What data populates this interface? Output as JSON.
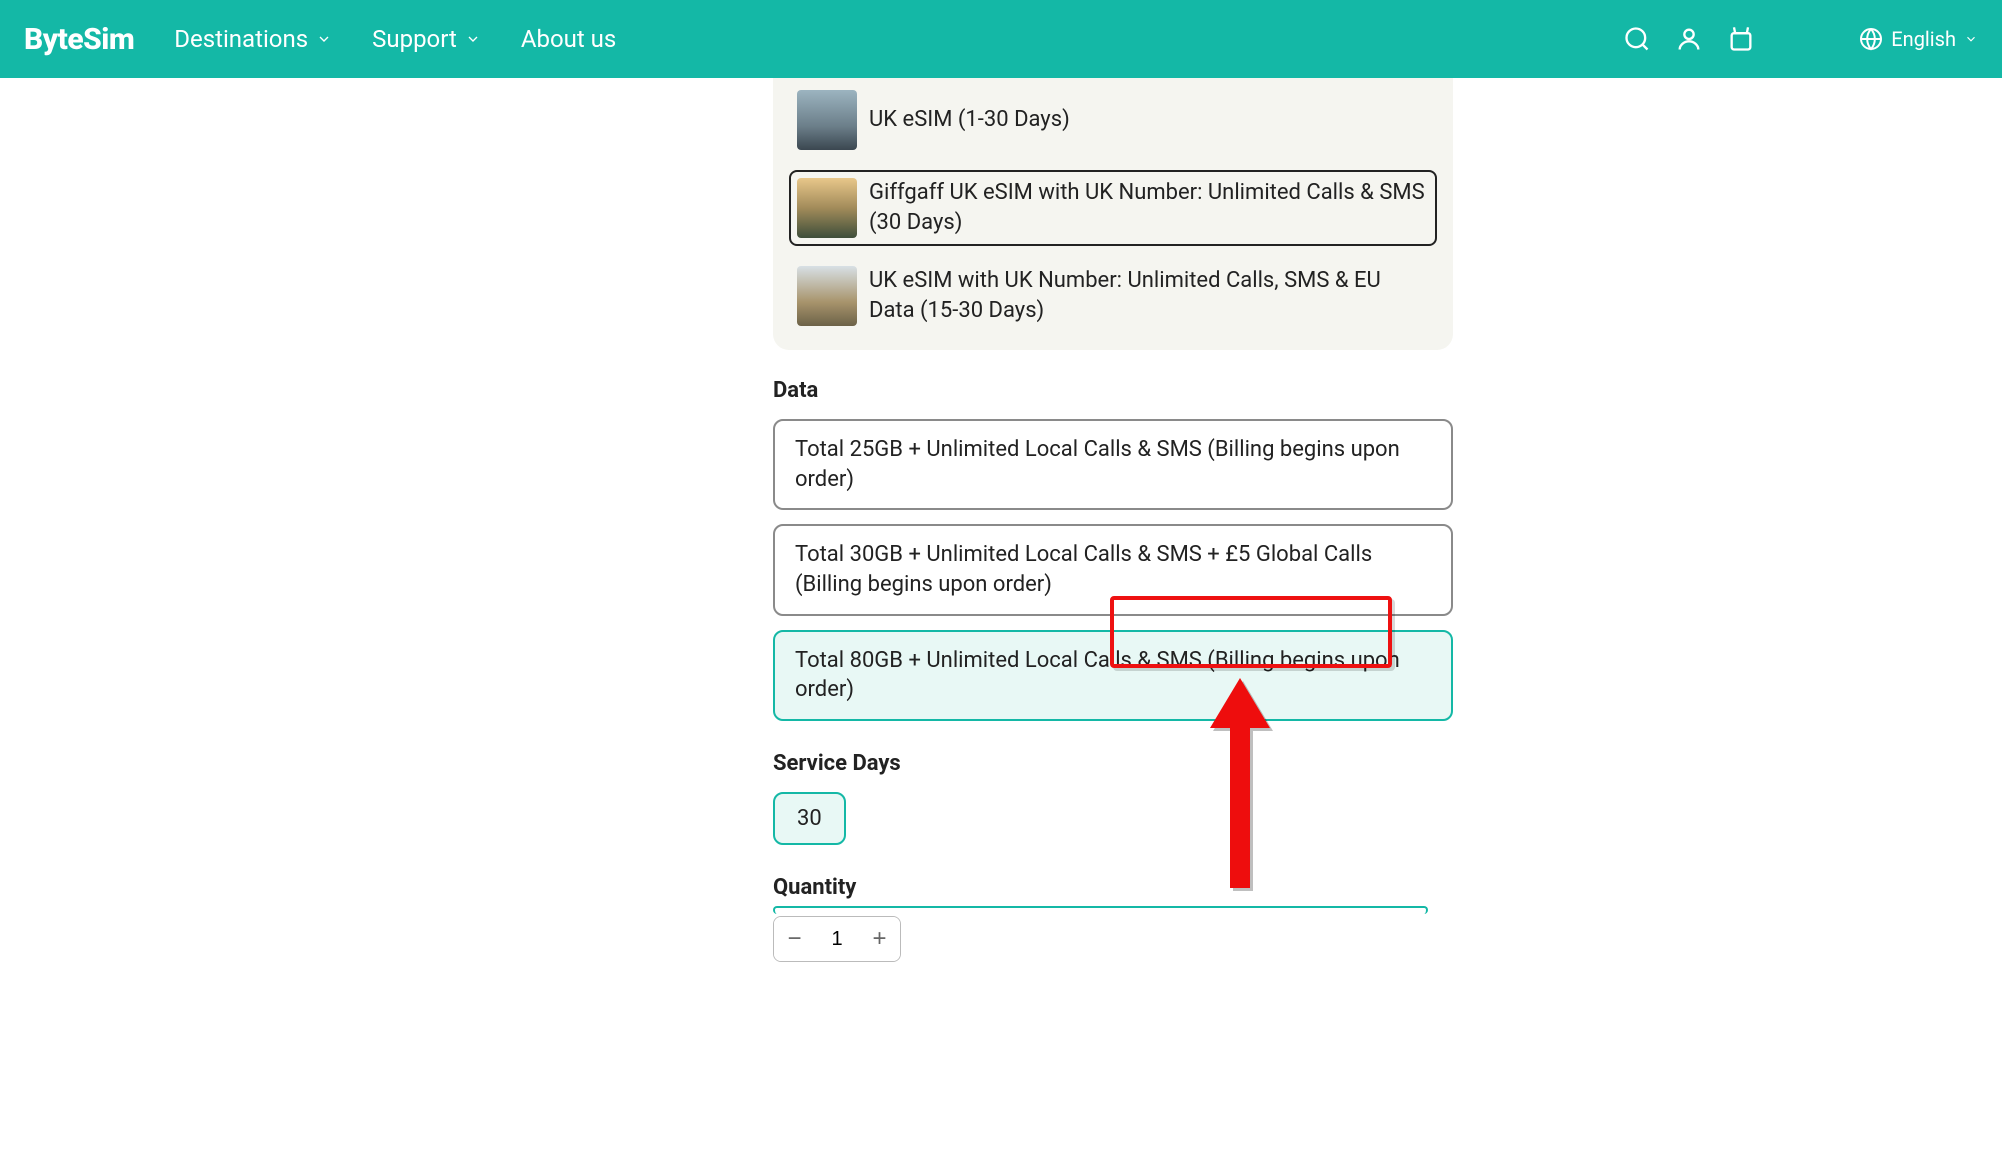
{
  "header": {
    "logo": "ByteSim",
    "nav": {
      "destinations": "Destinations",
      "support": "Support",
      "about": "About us"
    },
    "language": "English"
  },
  "products": {
    "items": [
      {
        "label": "UK eSIM (1-30 Days)",
        "selected": false
      },
      {
        "label": "Giffgaff UK eSIM with UK Number: Unlimited Calls & SMS (30 Days)",
        "selected": true
      },
      {
        "label": "UK eSIM with UK Number: Unlimited Calls, SMS & EU Data (15-30 Days)",
        "selected": false
      }
    ]
  },
  "data_section": {
    "title": "Data",
    "options": [
      {
        "label": "Total 25GB + Unlimited Local Calls & SMS (Billing begins upon order)",
        "selected": false
      },
      {
        "label": "Total 30GB + Unlimited Local Calls & SMS + £5 Global Calls (Billing begins upon order)",
        "selected": false
      },
      {
        "label": "Total 80GB + Unlimited Local Calls & SMS (Billing begins upon order)",
        "selected": true
      }
    ]
  },
  "service_days": {
    "title": "Service Days",
    "value": "30"
  },
  "quantity": {
    "title": "Quantity",
    "value": "1"
  },
  "icons": {
    "search": "search-icon",
    "account": "account-icon",
    "cart": "cart-icon",
    "globe": "globe-icon",
    "chevron_down": "chevron-down-icon",
    "minus": "minus-icon",
    "plus": "plus-icon"
  }
}
